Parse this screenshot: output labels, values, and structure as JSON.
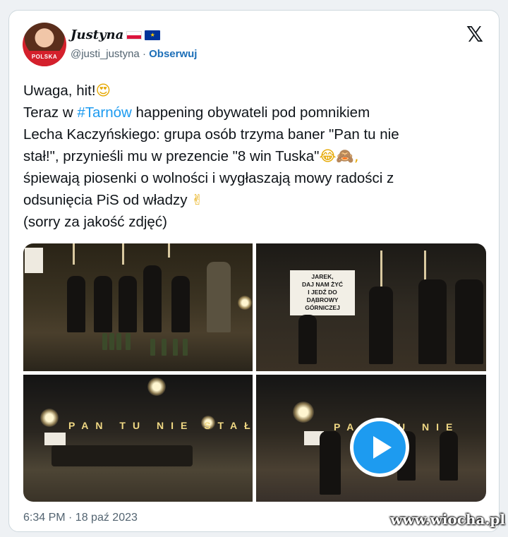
{
  "author": {
    "display_name": "Justyna",
    "flags": [
      "poland-flag-icon",
      "eu-flag-icon"
    ],
    "avatar_shirt_text": "POLSKA",
    "handle": "@justi_justyna",
    "separator": "·",
    "follow_label": "Obserwuj"
  },
  "header": {
    "x_logo": "𝕏"
  },
  "tweet": {
    "line1": "Uwaga, hit!",
    "line1_emoji": "😍",
    "line2_before": "Teraz w ",
    "line2_hashtag": "#Tarnów",
    "line2_after": " happening obywateli pod pomnikiem",
    "line3": "Lecha Kaczyńskiego: grupa osób trzyma baner \"Pan tu nie",
    "line4": "stał!\", przynieśli mu w prezencie \"8 win Tuska\"",
    "line4_emoji": "😂🙈,",
    "line5": "śpiewają piosenki o wolności i wygłaszają mowy radości z",
    "line6": "odsunięcia PiS od władzy",
    "line6_emoji": "✌",
    "line7": "(sorry za jakość zdjęć)"
  },
  "media": {
    "banner_text": [
      "JAREK,",
      "DAJ NAM ŻYĆ",
      "I JEDŹ DO",
      "DĄBROWY",
      "GÓRNICZEJ"
    ],
    "letters_photo3": "PAN TU NIE STAŁ",
    "letters_photo4": "PAN TU NIE",
    "play_icon": "play-icon"
  },
  "footer": {
    "timestamp": "6:34 PM · 18 paź 2023",
    "watermark": "www.wiocha.pl"
  },
  "colors": {
    "hashtag": "#1d9bf0",
    "follow": "#1d6fb8",
    "play_button": "#1d9bf0",
    "muted": "#536471"
  }
}
